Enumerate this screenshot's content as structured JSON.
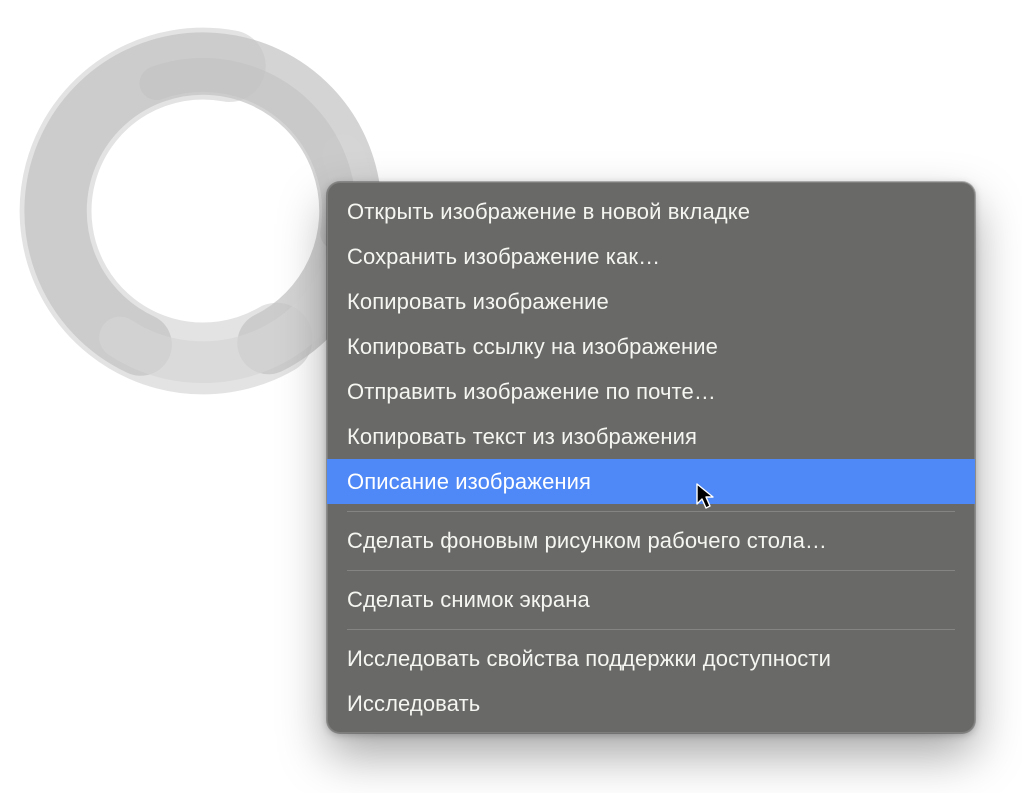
{
  "highlighted_index": 6,
  "menu": {
    "items": [
      {
        "label": "Открыть изображение в новой вкладке",
        "separator_after": false
      },
      {
        "label": "Сохранить изображение как…",
        "separator_after": false
      },
      {
        "label": "Копировать изображение",
        "separator_after": false
      },
      {
        "label": "Копировать ссылку на изображение",
        "separator_after": false
      },
      {
        "label": "Отправить изображение по почте…",
        "separator_after": false
      },
      {
        "label": "Копировать текст из изображения",
        "separator_after": false
      },
      {
        "label": "Описание изображения",
        "separator_after": true
      },
      {
        "label": "Сделать фоновым рисунком рабочего стола…",
        "separator_after": true
      },
      {
        "label": "Сделать снимок экрана",
        "separator_after": true
      },
      {
        "label": "Исследовать свойства поддержки доступности",
        "separator_after": false
      },
      {
        "label": "Исследовать",
        "separator_after": false
      }
    ]
  }
}
